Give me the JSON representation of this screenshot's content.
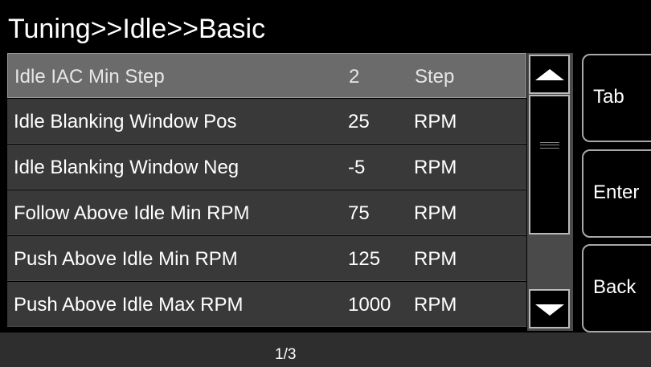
{
  "header": {
    "title": "Tuning>>Idle>>Basic"
  },
  "list": {
    "rows": [
      {
        "name": "Idle IAC Min Step",
        "value": "2",
        "unit": "Step",
        "selected": true
      },
      {
        "name": "Idle Blanking Window Pos",
        "value": "25",
        "unit": "RPM",
        "selected": false
      },
      {
        "name": "Idle Blanking Window Neg",
        "value": "-5",
        "unit": "RPM",
        "selected": false
      },
      {
        "name": "Follow Above Idle Min RPM",
        "value": "75",
        "unit": "RPM",
        "selected": false
      },
      {
        "name": "Push Above Idle Min RPM",
        "value": "125",
        "unit": "RPM",
        "selected": false
      },
      {
        "name": "Push Above Idle Max RPM",
        "value": "1000",
        "unit": "RPM",
        "selected": false
      }
    ]
  },
  "scrollbar": {
    "up_icon": "arrow-up-icon",
    "down_icon": "arrow-down-icon"
  },
  "side_buttons": {
    "tab": "Tab",
    "enter": "Enter",
    "back": "Back"
  },
  "footer": {
    "page": "1/3"
  },
  "colors": {
    "background": "#000000",
    "row": "#393939",
    "row_selected": "#6b6b6b",
    "footer": "#2e2e2e",
    "text": "#ffffff"
  }
}
